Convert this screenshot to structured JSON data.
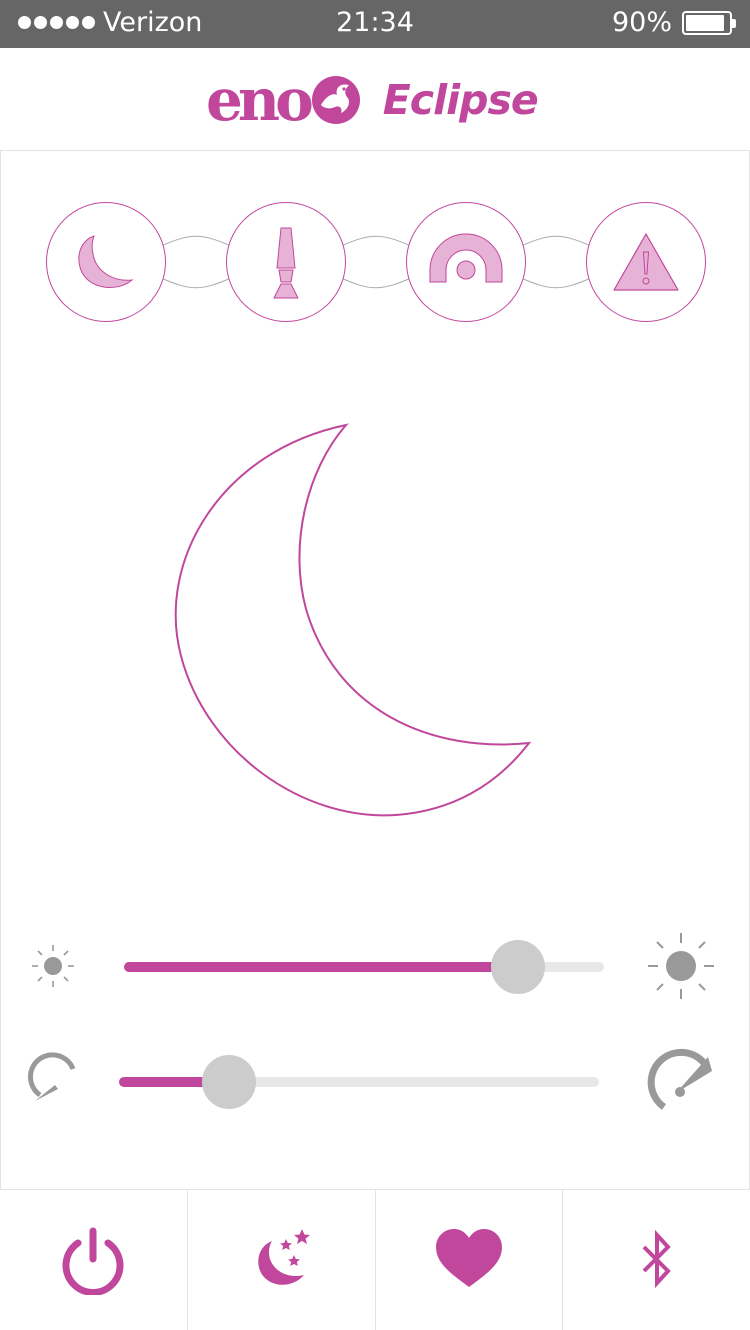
{
  "status_bar": {
    "carrier": "Verizon",
    "time": "21:34",
    "battery_percent": "90%",
    "battery_level": 0.9
  },
  "header": {
    "brand": "eno",
    "product": "Eclipse"
  },
  "modes": [
    {
      "name": "night-light",
      "icon": "crescent-moon-icon"
    },
    {
      "name": "lava-lamp",
      "icon": "lava-lamp-icon"
    },
    {
      "name": "rainbow",
      "icon": "rainbow-icon"
    },
    {
      "name": "alert",
      "icon": "warning-icon"
    }
  ],
  "selected_mode": "night-light",
  "brightness_slider": {
    "value": 0.82,
    "min_icon": "sun-small-icon",
    "max_icon": "sun-large-icon"
  },
  "speed_slider": {
    "value": 0.23,
    "min_icon": "speedometer-slow-icon",
    "max_icon": "speedometer-fast-icon"
  },
  "tabs": [
    {
      "name": "power",
      "icon": "power-icon"
    },
    {
      "name": "sleep",
      "icon": "moon-stars-icon"
    },
    {
      "name": "favorites",
      "icon": "heart-icon"
    },
    {
      "name": "bluetooth",
      "icon": "bluetooth-icon"
    }
  ],
  "colors": {
    "accent": "#c0479b",
    "accent_light": "#e6b3d6",
    "status_bar": "#666666",
    "thumb": "#cccccc",
    "icon_gray": "#999999"
  }
}
